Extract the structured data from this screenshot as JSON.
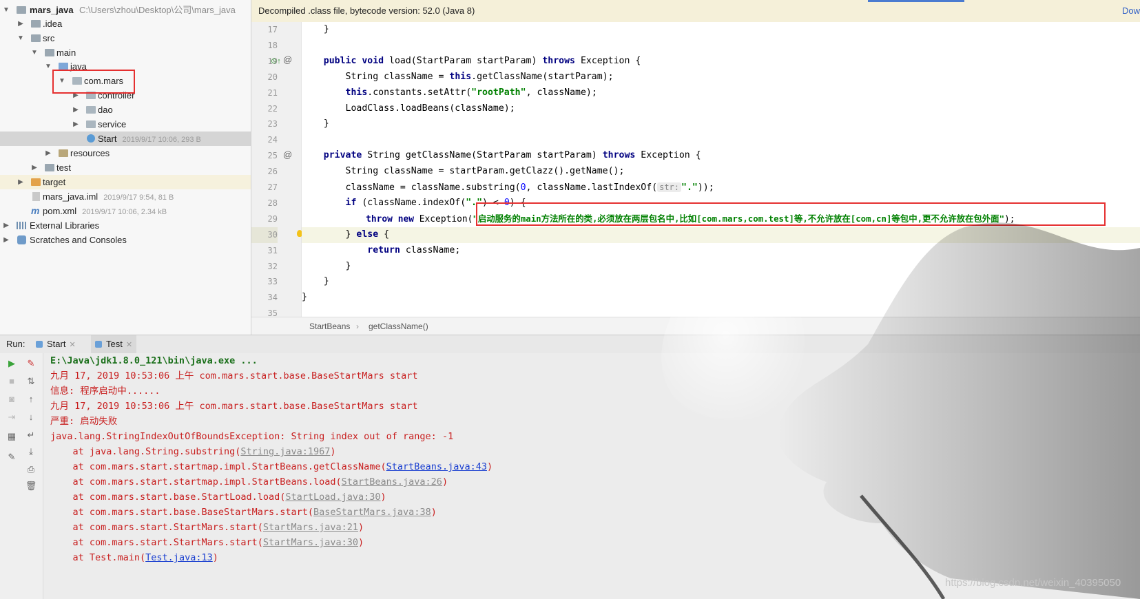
{
  "project_tree": {
    "root_name": "mars_java",
    "root_path": "C:\\Users\\zhou\\Desktop\\公司\\mars_java",
    "items": [
      {
        "label": "mars_java"
      },
      {
        "label": ".idea"
      },
      {
        "label": "src"
      },
      {
        "label": "main"
      },
      {
        "label": "java"
      },
      {
        "label": "com.mars"
      },
      {
        "label": "controller"
      },
      {
        "label": "dao"
      },
      {
        "label": "service"
      },
      {
        "label": "Start",
        "meta": "2019/9/17 10:06, 293 B"
      },
      {
        "label": "resources"
      },
      {
        "label": "test"
      },
      {
        "label": "target"
      },
      {
        "label": "mars_java.iml",
        "meta": "2019/9/17 9:54, 81 B"
      },
      {
        "label": "pom.xml",
        "meta": "2019/9/17 10:06, 2.34 kB"
      },
      {
        "label": "External Libraries"
      },
      {
        "label": "Scratches and Consoles"
      }
    ]
  },
  "editor": {
    "banner": "Decompiled .class file, bytecode version: 52.0 (Java 8)",
    "banner_action": "Dow",
    "line_numbers": [
      "17",
      "18",
      "19",
      "20",
      "21",
      "22",
      "23",
      "24",
      "25",
      "26",
      "27",
      "28",
      "29",
      "30",
      "31",
      "32",
      "33",
      "34",
      "35"
    ],
    "code": {
      "l17": "    }",
      "l19_kw1": "public void",
      "l19_mid": " load(StartParam startParam) ",
      "l19_kw2": "throws",
      "l19_end": " Exception {",
      "l20_pre": "        String className = ",
      "l20_kw": "this",
      "l20_end": ".getClassName(startParam);",
      "l21_kw": "this",
      "l21_mid": ".constants.setAttr(",
      "l21_str": "\"rootPath\"",
      "l21_end": ", className);",
      "l22": "        LoadClass.loadBeans(className);",
      "l23": "    }",
      "l25_kw1": "private",
      "l25_mid": " String getClassName(StartParam startParam) ",
      "l25_kw2": "throws",
      "l25_end": " Exception {",
      "l26": "        String className = startParam.getClazz().getName();",
      "l27_pre": "        className = className.substring(",
      "l27_num": "0",
      "l27_mid": ", className.lastIndexOf(",
      "l27_hint": "str:",
      "l27_str": "\".\"",
      "l27_end": "));",
      "l28_kw": "if",
      "l28_mid": " (className.indexOf(",
      "l28_str": "\".\"",
      "l28_op": ") < ",
      "l28_num": "0",
      "l28_end": ") {",
      "l29_kw1": "throw",
      "l29_kw2": "new",
      "l29_mid": " Exception(",
      "l29_str": "\"启动服务的main方法所在的类,必须放在两层包名中,比如[com.mars,com.test]等,不允许放在[com,cn]等包中,更不允许放在包外面\"",
      "l29_end": ");",
      "l30_pre": "        } ",
      "l30_kw": "else",
      "l30_end": " {",
      "l31_kw": "return",
      "l31_end": " className;",
      "l32": "        }",
      "l33": "    }",
      "l34": "}"
    },
    "breadcrumb": [
      "StartBeans",
      "getClassName()"
    ]
  },
  "run_panel": {
    "label": "Run:",
    "tabs": [
      "Start",
      "Test"
    ],
    "console": {
      "cmd": "E:\\Java\\jdk1.8.0_121\\bin\\java.exe ...",
      "lines": [
        "九月 17, 2019 10:53:06 上午 com.mars.start.base.BaseStartMars start",
        "信息: 程序启动中......",
        "九月 17, 2019 10:53:06 上午 com.mars.start.base.BaseStartMars start",
        "严重: 启动失败",
        "java.lang.StringIndexOutOfBoundsException: String index out of range: -1"
      ],
      "stack": [
        {
          "pre": "    at java.lang.String.substring(",
          "link": "String.java:1967",
          "blue": false
        },
        {
          "pre": "    at com.mars.start.startmap.impl.StartBeans.getClassName(",
          "link": "StartBeans.java:43",
          "blue": true
        },
        {
          "pre": "    at com.mars.start.startmap.impl.StartBeans.load(",
          "link": "StartBeans.java:26",
          "blue": false
        },
        {
          "pre": "    at com.mars.start.base.StartLoad.load(",
          "link": "StartLoad.java:30",
          "blue": false
        },
        {
          "pre": "    at com.mars.start.base.BaseStartMars.start(",
          "link": "BaseStartMars.java:38",
          "blue": false
        },
        {
          "pre": "    at com.mars.start.StartMars.start(",
          "link": "StartMars.java:21",
          "blue": false
        },
        {
          "pre": "    at com.mars.start.StartMars.start(",
          "link": "StartMars.java:30",
          "blue": false
        },
        {
          "pre": "    at Test.main(",
          "link": "Test.java:13",
          "blue": true
        }
      ]
    }
  },
  "watermark": "https://blog.csdn.net/weixin_40395050",
  "colors": {
    "keyword": "#000080",
    "string": "#008000",
    "error": "#c81e1e",
    "highlight_box": "#e53030"
  }
}
